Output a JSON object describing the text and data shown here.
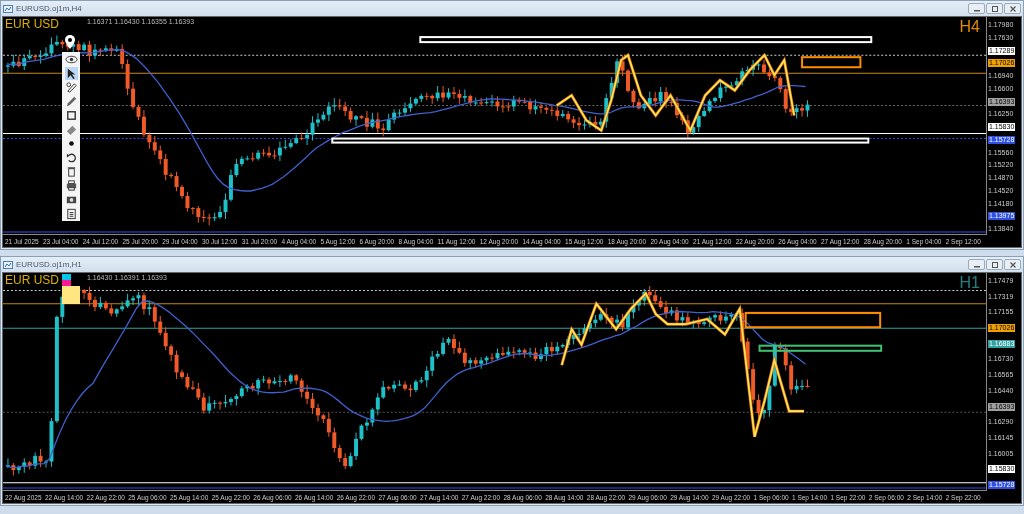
{
  "windows": [
    {
      "title": "EURUSD.oj1m,H4",
      "symbol": "EUR USD",
      "timeframe": "H4",
      "ohlc": "1.16371 1.16430 1.16355 1.16393",
      "price_labels": [
        {
          "text": "1.17980",
          "kind": "tick"
        },
        {
          "text": "1.17630",
          "kind": "tick"
        },
        {
          "text": "1.17289",
          "kind": "marker",
          "color": "#ffffff"
        },
        {
          "text": "1.17026",
          "kind": "marker",
          "color": "#f0a000"
        },
        {
          "text": "1.16940",
          "kind": "tick"
        },
        {
          "text": "1.16600",
          "kind": "tick"
        },
        {
          "text": "1.16393",
          "kind": "marker",
          "color": "#a0a0a0"
        },
        {
          "text": "1.16250",
          "kind": "tick"
        },
        {
          "text": "1.15830",
          "kind": "marker",
          "color": "#ffffff"
        },
        {
          "text": "1.15728",
          "kind": "marker",
          "color": "#3050e0"
        },
        {
          "text": "1.15560",
          "kind": "tick"
        },
        {
          "text": "1.15220",
          "kind": "tick"
        },
        {
          "text": "1.14870",
          "kind": "tick"
        },
        {
          "text": "1.14520",
          "kind": "tick"
        },
        {
          "text": "1.14180",
          "kind": "tick"
        },
        {
          "text": "1.13975",
          "kind": "marker",
          "color": "#3050e0"
        },
        {
          "text": "1.13840",
          "kind": "tick"
        }
      ],
      "time_labels": [
        "21 Jul 2025",
        "23 Jul 04:00",
        "24 Jul 12:00",
        "25 Jul 20:00",
        "29 Jul 04:00",
        "30 Jul 12:00",
        "31 Jul 20:00",
        "4 Aug 04:00",
        "5 Aug 12:00",
        "6 Aug 20:00",
        "8 Aug 04:00",
        "11 Aug 12:00",
        "12 Aug 20:00",
        "14 Aug 04:00",
        "15 Aug 12:00",
        "18 Aug 20:00",
        "20 Aug 04:00",
        "21 Aug 12:00",
        "22 Aug 20:00",
        "26 Aug 04:00",
        "27 Aug 12:00",
        "28 Aug 20:00",
        "1 Sep 04:00",
        "2 Sep 12:00"
      ]
    },
    {
      "title": "EURUSD.oj1m,H1",
      "symbol": "EUR USD",
      "timeframe": "H1",
      "ohlc": "1.16430 1.16391 1.16393",
      "price_labels": [
        {
          "text": "1.17479",
          "kind": "tick"
        },
        {
          "text": "1.17319",
          "kind": "tick"
        },
        {
          "text": "1.17155",
          "kind": "tick"
        },
        {
          "text": "1.17026",
          "kind": "marker",
          "color": "#f0a000"
        },
        {
          "text": "1.16883",
          "kind": "marker",
          "color": "#30a0a0"
        },
        {
          "text": "1.16730",
          "kind": "tick"
        },
        {
          "text": "1.16565",
          "kind": "tick"
        },
        {
          "text": "1.16440",
          "kind": "tick"
        },
        {
          "text": "1.16393",
          "kind": "marker",
          "color": "#a0a0a0"
        },
        {
          "text": "1.16290",
          "kind": "tick"
        },
        {
          "text": "1.16145",
          "kind": "tick"
        },
        {
          "text": "1.16005",
          "kind": "tick"
        },
        {
          "text": "1.15830",
          "kind": "marker",
          "color": "#ffffff"
        },
        {
          "text": "1.15728",
          "kind": "marker",
          "color": "#3050e0"
        }
      ],
      "time_labels": [
        "22 Aug 2025",
        "22 Aug 14:00",
        "22 Aug 22:00",
        "25 Aug 06:00",
        "25 Aug 14:00",
        "25 Aug 22:00",
        "26 Aug 06:00",
        "26 Aug 14:00",
        "26 Aug 22:00",
        "27 Aug 06:00",
        "27 Aug 14:00",
        "27 Aug 22:00",
        "28 Aug 06:00",
        "28 Aug 14:00",
        "28 Aug 22:00",
        "29 Aug 06:00",
        "29 Aug 14:00",
        "29 Aug 22:00",
        "1 Sep 06:00",
        "1 Sep 14:00",
        "1 Sep 22:00",
        "2 Sep 06:00",
        "2 Sep 14:00",
        "2 Sep 22:00"
      ]
    }
  ]
}
